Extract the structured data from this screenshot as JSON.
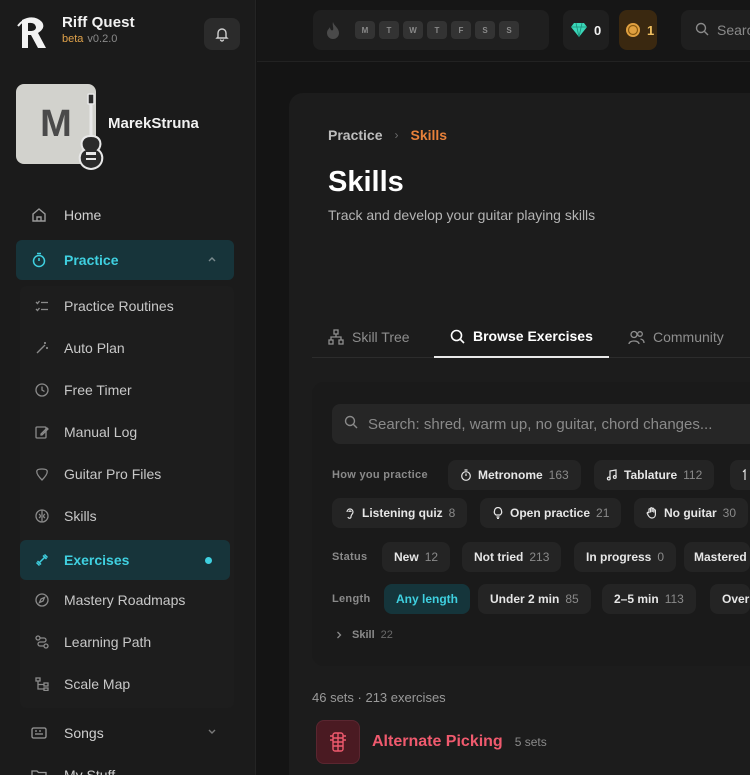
{
  "app": {
    "name": "Riff Quest",
    "beta": "beta",
    "version": "v0.2.0"
  },
  "user": {
    "initial": "M",
    "name": "MarekStruna"
  },
  "nav": {
    "home": "Home",
    "practice": "Practice",
    "practice_sub": [
      "Practice Routines",
      "Auto Plan",
      "Free Timer",
      "Manual Log",
      "Guitar Pro Files",
      "Skills",
      "Exercises",
      "Mastery Roadmaps",
      "Learning Path",
      "Scale Map"
    ],
    "songs": "Songs",
    "my_stuff": "My Stuff"
  },
  "topbar": {
    "days": [
      "M",
      "T",
      "W",
      "T",
      "F",
      "S",
      "S"
    ],
    "gems": "0",
    "coins": "1",
    "search_placeholder": "Search"
  },
  "breadcrumb": {
    "parent": "Practice",
    "current": "Skills"
  },
  "page": {
    "title": "Skills",
    "subtitle": "Track and develop your guitar playing skills"
  },
  "tabs": [
    "Skill Tree",
    "Browse Exercises",
    "Community"
  ],
  "filters": {
    "search_placeholder": "Search: shred, warm up, no guitar, chord changes...",
    "how_label": "How you practice",
    "how": [
      {
        "label": "Metronome",
        "count": "163"
      },
      {
        "label": "Tablature",
        "count": "112"
      },
      {
        "label": "Listening quiz",
        "count": "8"
      },
      {
        "label": "Open practice",
        "count": "21"
      },
      {
        "label": "No guitar",
        "count": "30"
      }
    ],
    "status_label": "Status",
    "status": [
      {
        "label": "New",
        "count": "12"
      },
      {
        "label": "Not tried",
        "count": "213"
      },
      {
        "label": "In progress",
        "count": "0"
      },
      {
        "label": "Mastered",
        "count": ""
      }
    ],
    "length_label": "Length",
    "length": [
      {
        "label": "Any length",
        "count": ""
      },
      {
        "label": "Under 2 min",
        "count": "85"
      },
      {
        "label": "2–5 min",
        "count": "113"
      },
      {
        "label": "Over",
        "count": ""
      }
    ],
    "skill_label": "Skill",
    "skill_count": "22"
  },
  "results": {
    "summary": "46 sets · 213 exercises"
  },
  "category": {
    "name": "Alternate Picking",
    "count": "5 sets"
  },
  "colors": {
    "accent": "#3fd0e0",
    "orange": "#e8813a",
    "red": "#f05a6e"
  }
}
